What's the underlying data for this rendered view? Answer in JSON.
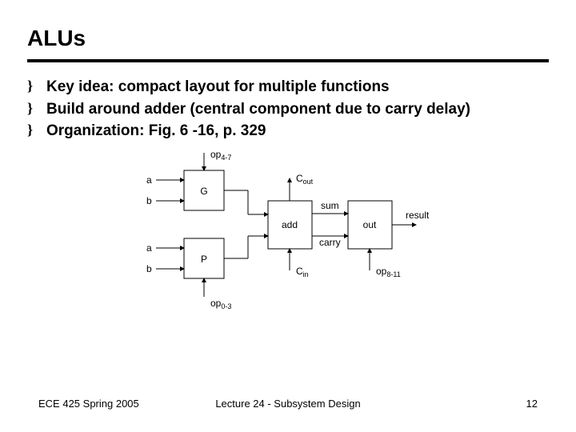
{
  "title": "ALUs",
  "bullets": [
    "Key idea: compact layout for multiple functions",
    "Build around adder (central component due to carry delay)",
    "Organization: Fig. 6 -16, p. 329"
  ],
  "bullet_marker": "}",
  "diagram": {
    "signals": {
      "a1": "a",
      "b1": "b",
      "a2": "a",
      "b2": "b",
      "op_top": "op",
      "op_top_sub": "4-7",
      "op_bot": "op",
      "op_bot_sub": "0-3",
      "cout": "C",
      "cout_sub": "out",
      "cin": "C",
      "cin_sub": "in",
      "sum": "sum",
      "carry": "carry",
      "op_right": "op",
      "op_right_sub": "8-11",
      "result": "result"
    },
    "blocks": {
      "g": "G",
      "p": "P",
      "add": "add",
      "out": "out"
    }
  },
  "footer": {
    "left": "ECE 425 Spring 2005",
    "center": "Lecture 24 - Subsystem Design",
    "page": "12"
  }
}
